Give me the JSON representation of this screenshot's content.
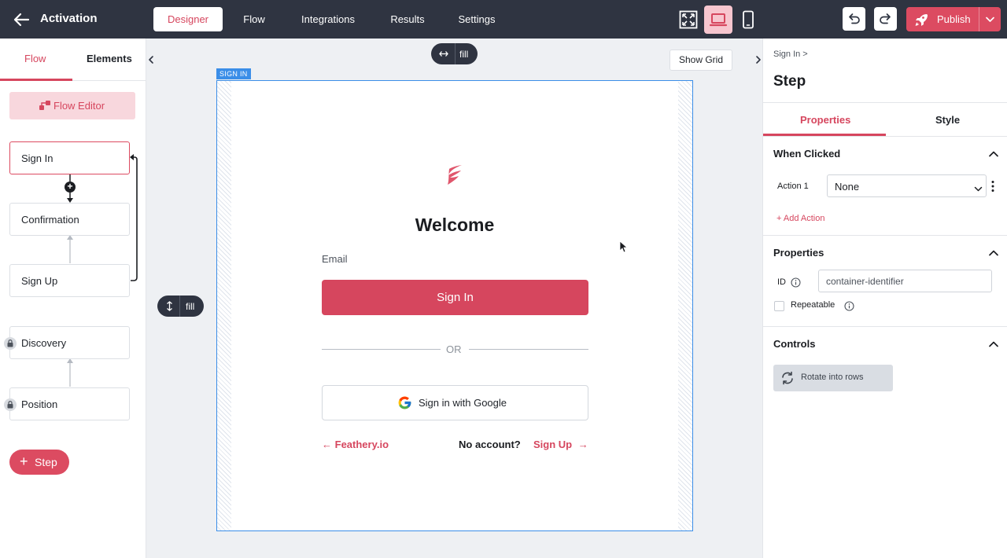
{
  "app": {
    "title": "Activation"
  },
  "nav_tabs": [
    {
      "label": "Designer",
      "active": true
    },
    {
      "label": "Flow",
      "active": false
    },
    {
      "label": "Integrations",
      "active": false
    },
    {
      "label": "Results",
      "active": false
    },
    {
      "label": "Settings",
      "active": false
    }
  ],
  "toolbar": {
    "device_icons": [
      "fullscreen-icon",
      "laptop-icon",
      "mobile-icon"
    ],
    "active_device": "laptop-icon",
    "undo_icon": "undo-icon",
    "redo_icon": "redo-icon",
    "publish_label": "Publish"
  },
  "left_panel": {
    "tabs": [
      {
        "label": "Flow",
        "active": true
      },
      {
        "label": "Elements",
        "active": false
      }
    ],
    "flow_editor_label": "Flow Editor",
    "steps": [
      {
        "label": "Sign In",
        "selected": true,
        "locked": false
      },
      {
        "label": "Confirmation",
        "selected": false,
        "locked": false
      },
      {
        "label": "Sign Up",
        "selected": false,
        "locked": false
      },
      {
        "label": "Discovery",
        "selected": false,
        "locked": true
      },
      {
        "label": "Position",
        "selected": false,
        "locked": true
      }
    ],
    "add_step_label": "Step"
  },
  "canvas": {
    "width_pill": "fill",
    "height_pill": "fill",
    "show_grid_label": "Show Grid",
    "frame_label": "SIGN IN",
    "form": {
      "heading": "Welcome",
      "email_label": "Email",
      "sign_in_button": "Sign In",
      "divider_text": "OR",
      "google_button": "Sign in with Google",
      "feathery_link": "Feathery.io",
      "no_account_text": "No account?",
      "sign_up_link": "Sign Up"
    }
  },
  "right_panel": {
    "breadcrumb": "Sign In >",
    "title": "Step",
    "tabs": [
      {
        "label": "Properties",
        "active": true
      },
      {
        "label": "Style",
        "active": false
      }
    ],
    "when_clicked": {
      "heading": "When Clicked",
      "action_label": "Action 1",
      "action_value": "None",
      "add_action_label": "+ Add Action"
    },
    "properties": {
      "heading": "Properties",
      "id_label": "ID",
      "id_value": "container-identifier",
      "repeatable_label": "Repeatable",
      "repeatable_checked": false
    },
    "controls": {
      "heading": "Controls",
      "rotate_label": "Rotate into rows"
    }
  },
  "colors": {
    "brand": "#d6465e",
    "topbar": "#2f3441",
    "selection": "#3b8ee8"
  }
}
